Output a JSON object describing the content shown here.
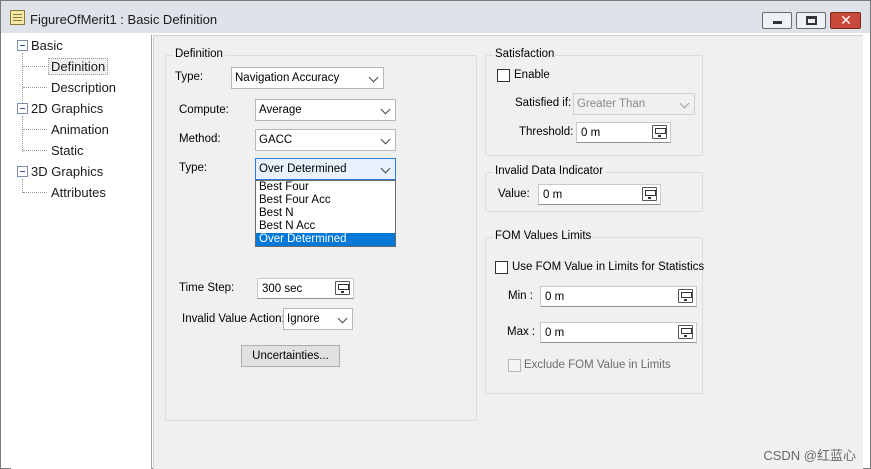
{
  "window": {
    "title": "FigureOfMerit1 : Basic Definition",
    "minimize_label": "",
    "maximize_label": "",
    "close_label": "✕"
  },
  "tree": {
    "groups": [
      {
        "label": "Basic",
        "items": [
          "Definition",
          "Description"
        ]
      },
      {
        "label": "2D Graphics",
        "items": [
          "Animation",
          "Static"
        ]
      },
      {
        "label": "3D Graphics",
        "items": [
          "Attributes"
        ]
      }
    ],
    "selected": "Definition"
  },
  "definition": {
    "group_label": "Definition",
    "type_label": "Type:",
    "type_value": "Navigation Accuracy",
    "compute_label": "Compute:",
    "compute_value": "Average",
    "method_label": "Method:",
    "method_value": "GACC",
    "subtype_label": "Type:",
    "subtype_value": "Over Determined",
    "subtype_options": [
      "Best Four",
      "Best Four Acc",
      "Best N",
      "Best N Acc",
      "Over Determined"
    ],
    "time_step_label": "Time Step:",
    "time_step_value": "300 sec",
    "invalid_action_label": "Invalid Value Action:",
    "invalid_action_value": "Ignore",
    "uncertainties_label": "Uncertainties..."
  },
  "satisfaction": {
    "group_label": "Satisfaction",
    "enable_label": "Enable",
    "enable_checked": false,
    "satisfied_if_label": "Satisfied if:",
    "satisfied_if_value": "Greater Than",
    "threshold_label": "Threshold:",
    "threshold_value": "0 m"
  },
  "invalid_data": {
    "group_label": "Invalid Data Indicator",
    "value_label": "Value:",
    "value": "0 m"
  },
  "fom_limits": {
    "group_label": "FOM Values Limits",
    "use_limits_label": "Use FOM Value in Limits for Statistics",
    "use_limits_checked": false,
    "min_label": "Min :",
    "min_value": "0 m",
    "max_label": "Max :",
    "max_value": "0 m",
    "exclude_label": "Exclude FOM Value in Limits",
    "exclude_checked": false
  },
  "watermark": "CSDN @红蓝心"
}
